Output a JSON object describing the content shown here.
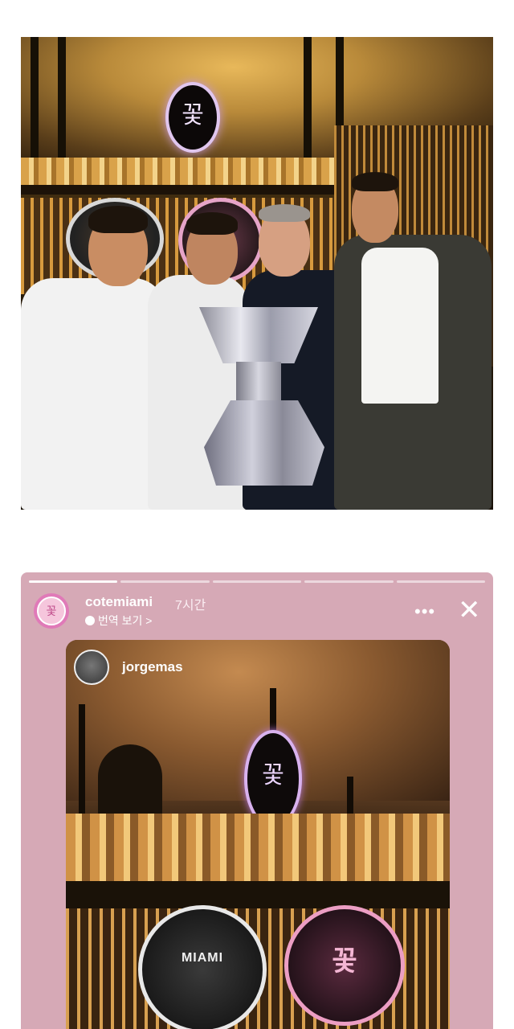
{
  "story": {
    "username": "cotemiami",
    "time_ago": "7시간",
    "translate_label": "번역 보기 >",
    "more_label": "•••",
    "close_label": "✕",
    "progress_segments": 5,
    "progress_done": 1
  },
  "reshare": {
    "username": "jorgemas"
  },
  "logos": {
    "flower_glyph": "꽃",
    "club_badge_word": "MIAMI"
  },
  "colors": {
    "story_background": "#d6a9b6",
    "avatar_ring": "#e07ab8",
    "sign_glow": "#d8b2ee"
  }
}
